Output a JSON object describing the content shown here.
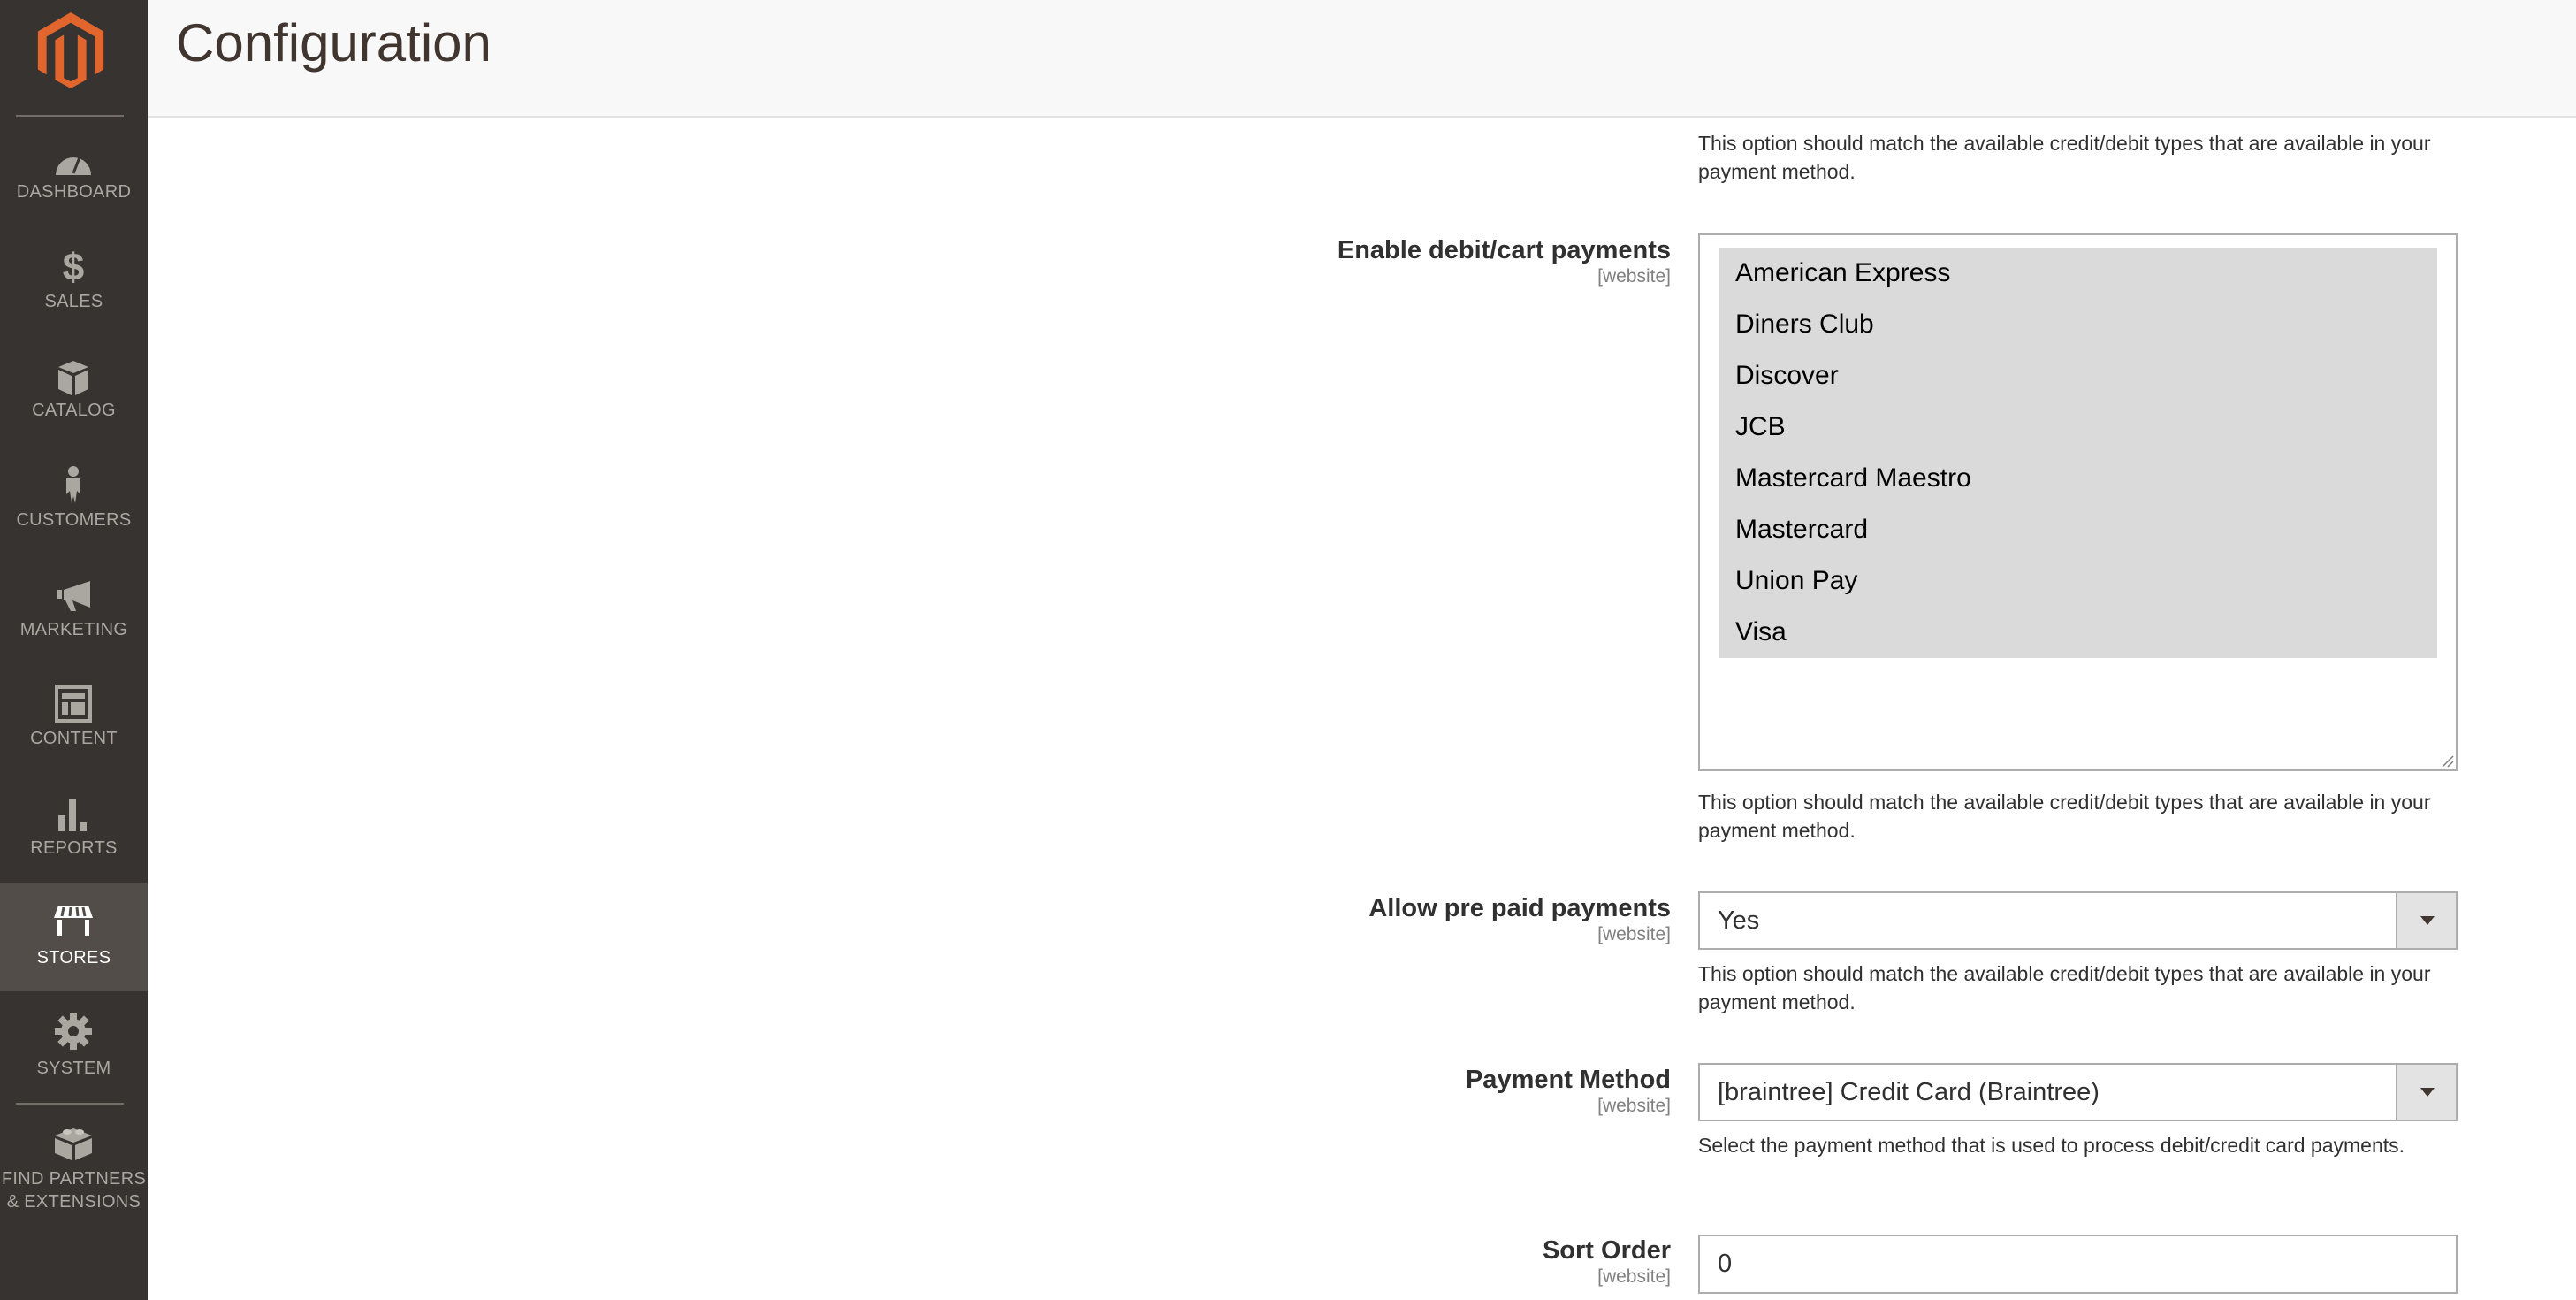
{
  "header": {
    "title": "Configuration"
  },
  "sidebar": {
    "items": [
      {
        "label": "DASHBOARD",
        "icon": "dashboard-icon"
      },
      {
        "label": "SALES",
        "icon": "dollar-icon"
      },
      {
        "label": "CATALOG",
        "icon": "box-icon"
      },
      {
        "label": "CUSTOMERS",
        "icon": "person-icon"
      },
      {
        "label": "MARKETING",
        "icon": "megaphone-icon"
      },
      {
        "label": "CONTENT",
        "icon": "layout-icon"
      },
      {
        "label": "REPORTS",
        "icon": "bar-chart-icon"
      },
      {
        "label": "STORES",
        "icon": "storefront-icon",
        "active": true
      },
      {
        "label": "SYSTEM",
        "icon": "gear-icon"
      },
      {
        "label_line1": "FIND PARTNERS",
        "label_line2": "& EXTENSIONS",
        "icon": "lego-brick-icon"
      }
    ],
    "brand_color": "#eb5202"
  },
  "form": {
    "top_help": "This option should match the available credit/debit types that are available in your payment method.",
    "enable_debit": {
      "label": "Enable debit/cart payments",
      "scope": "[website]",
      "options": [
        "American Express",
        "Diners Club",
        "Discover",
        "JCB",
        "Mastercard Maestro",
        "Mastercard",
        "Union Pay",
        "Visa"
      ],
      "help": "This option should match the available credit/debit types that are available in your payment method."
    },
    "allow_prepaid": {
      "label": "Allow pre paid payments",
      "scope": "[website]",
      "value": "Yes",
      "help": "This option should match the available credit/debit types that are available in your payment method."
    },
    "payment_method": {
      "label": "Payment Method",
      "scope": "[website]",
      "value": "[braintree] Credit Card (Braintree)",
      "help": "Select the payment method that is used to process debit/credit card payments."
    },
    "sort_order": {
      "label": "Sort Order",
      "scope": "[website]",
      "value": "0"
    }
  }
}
